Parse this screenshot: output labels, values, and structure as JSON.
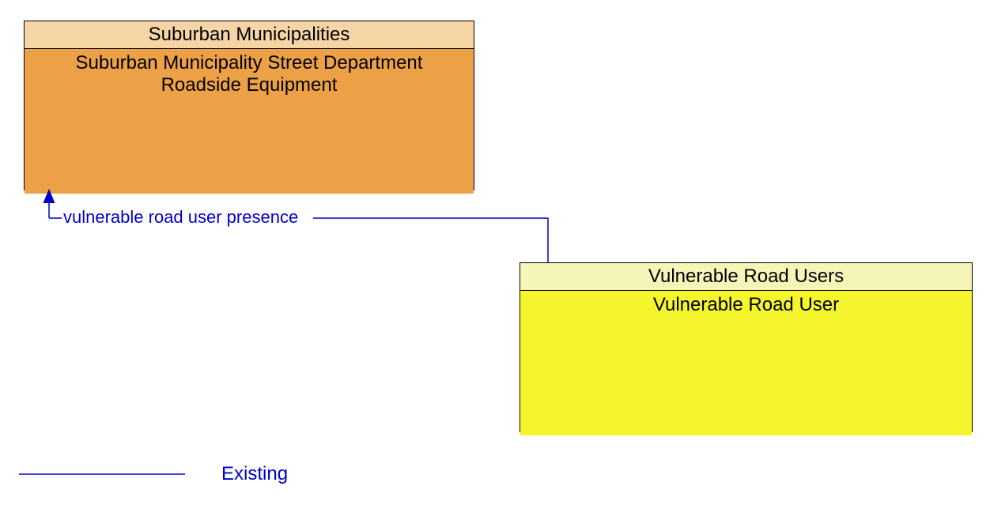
{
  "boxes": {
    "suburban": {
      "header": "Suburban Municipalities",
      "body": "Suburban Municipality Street Department Roadside Equipment"
    },
    "vulnerable": {
      "header": "Vulnerable Road Users",
      "body": "Vulnerable Road User"
    }
  },
  "flows": {
    "vru_presence": "vulnerable road user presence"
  },
  "legend": {
    "existing": "Existing"
  },
  "chart_data": {
    "type": "diagram",
    "title": "",
    "nodes": [
      {
        "id": "suburban_equipment",
        "stakeholder": "Suburban Municipalities",
        "element": "Suburban Municipality Street Department Roadside Equipment",
        "color": "orange"
      },
      {
        "id": "vulnerable_road_user",
        "stakeholder": "Vulnerable Road Users",
        "element": "Vulnerable Road User",
        "color": "yellow"
      }
    ],
    "edges": [
      {
        "from": "vulnerable_road_user",
        "to": "suburban_equipment",
        "label": "vulnerable road user presence",
        "status": "Existing",
        "style": "solid",
        "color": "#0000ce"
      }
    ],
    "legend": [
      {
        "label": "Existing",
        "style": "solid",
        "color": "#0000ce"
      }
    ]
  }
}
